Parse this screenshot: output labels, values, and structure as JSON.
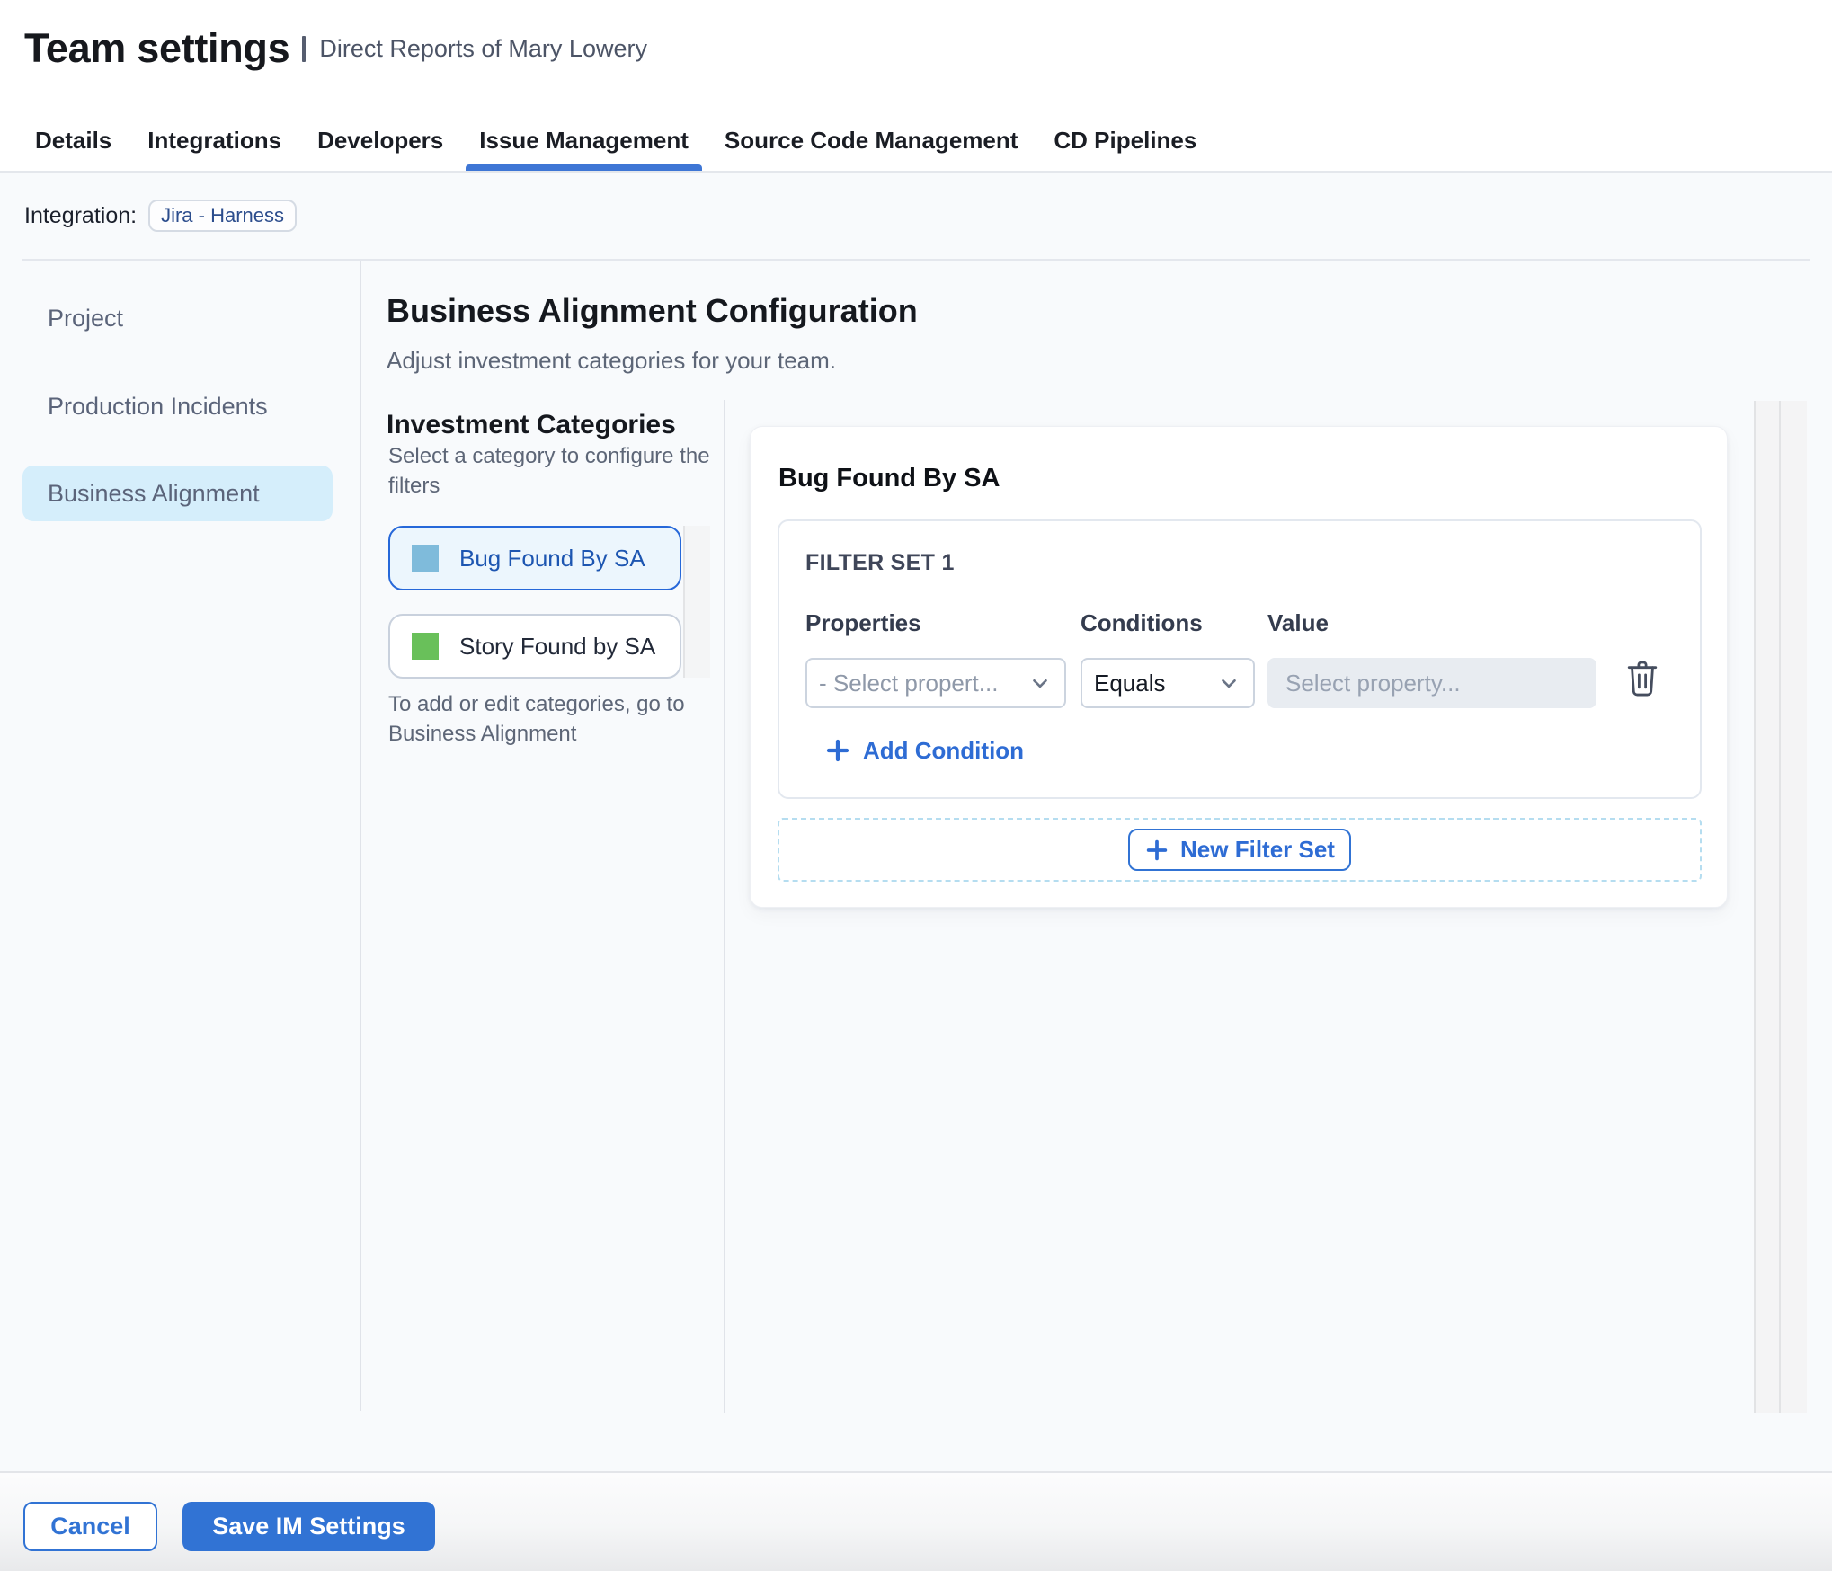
{
  "header": {
    "title": "Team settings",
    "subtitle": "Direct Reports of Mary Lowery"
  },
  "tabs": [
    {
      "label": "Details",
      "active": false
    },
    {
      "label": "Integrations",
      "active": false
    },
    {
      "label": "Developers",
      "active": false
    },
    {
      "label": "Issue Management",
      "active": true
    },
    {
      "label": "Source Code Management",
      "active": false
    },
    {
      "label": "CD Pipelines",
      "active": false
    }
  ],
  "integration": {
    "label": "Integration:",
    "value": "Jira - Harness"
  },
  "sidebar": {
    "items": [
      {
        "label": "Project",
        "active": false
      },
      {
        "label": "Production Incidents",
        "active": false
      },
      {
        "label": "Business Alignment",
        "active": true
      }
    ]
  },
  "main": {
    "title": "Business Alignment Configuration",
    "subtitle": "Adjust investment categories for your team.",
    "categories": {
      "heading": "Investment Categories",
      "description": "Select a category to configure the filters",
      "items": [
        {
          "label": "Bug Found By SA",
          "color": "#7fbbdb",
          "selected": true
        },
        {
          "label": "Story Found by SA",
          "color": "#69c05a",
          "selected": false
        }
      ],
      "footnote": "To add or edit categories, go to Business Alignment"
    },
    "filter_panel": {
      "title": "Bug Found By SA",
      "filter_set": {
        "title": "FILTER SET 1",
        "columns": [
          "Properties",
          "Conditions",
          "Value"
        ],
        "property_placeholder": "- Select propert...",
        "condition_value": "Equals",
        "value_placeholder": "Select property...",
        "add_condition_label": "Add Condition"
      },
      "new_filter_set_label": "New Filter Set"
    }
  },
  "footer": {
    "cancel_label": "Cancel",
    "save_label": "Save IM Settings"
  },
  "colors": {
    "underline_blue": "#3e76d5",
    "link_blue": "#2e6cd4",
    "button_blue": "#3173d4",
    "chip_text": "#2c4d8d",
    "pill_bg": "#d5eefb",
    "category_selected_bg": "#ecf6fd",
    "category_selected_border": "#2668d9",
    "category_selected_text": "#1d56b1"
  }
}
